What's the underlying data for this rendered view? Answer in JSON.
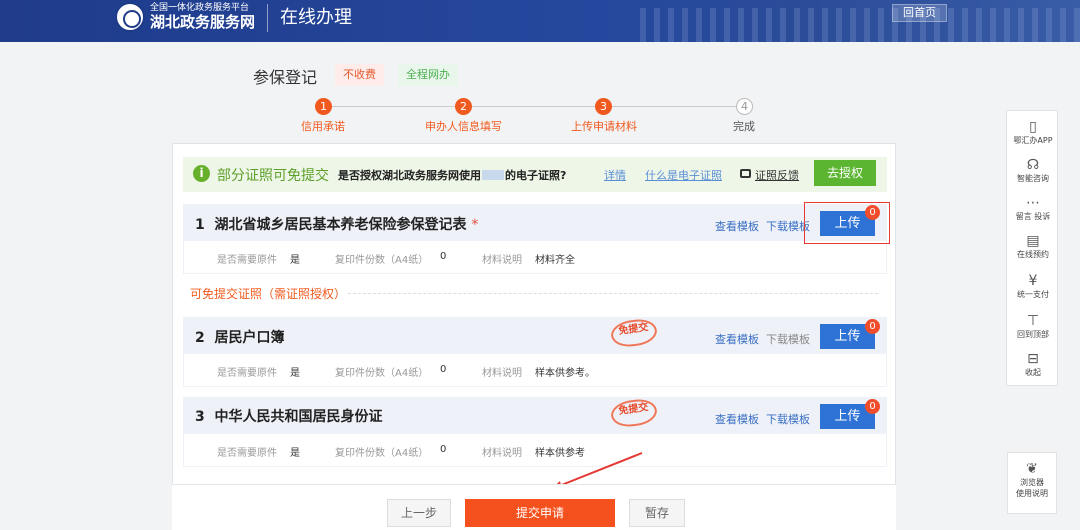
{
  "header": {
    "platform_tag": "全国一体化政务服务平台",
    "site_name": "湖北政务服务网",
    "title": "在线办理",
    "home_button": "回首页"
  },
  "service": {
    "title": "参保登记",
    "fee_tag": "不收费",
    "online_tag": "全程网办"
  },
  "steps": [
    {
      "num": "1",
      "label": "信用承诺",
      "state": "done"
    },
    {
      "num": "2",
      "label": "申办人信息填写",
      "state": "done"
    },
    {
      "num": "3",
      "label": "上传申请材料",
      "state": "current"
    },
    {
      "num": "4",
      "label": "完成",
      "state": "todo"
    }
  ],
  "notice": {
    "title": "部分证照可免提交",
    "question": "是否授权湖北政务服务网使用",
    "question_tail": "的电子证照?",
    "details_link": "详情",
    "what_is_link": "什么是电子证照",
    "feedback_link": "证照反馈",
    "authorize_button": "去授权"
  },
  "meta_labels": {
    "original": "是否需要原件",
    "copies": "复印件份数（A4纸）",
    "note": "材料说明"
  },
  "materials": [
    {
      "index": "1",
      "name": "湖北省城乡居民基本养老保险参保登记表",
      "required_mark": "*",
      "view_template": "查看模板",
      "download_template": "下载模板",
      "upload": "上传",
      "badge": "0",
      "original": "是",
      "copies": "0",
      "note": "材料齐全"
    },
    {
      "index": "2",
      "name": "居民户口簿",
      "view_template": "查看模板",
      "download_template": "下载模板",
      "upload": "上传",
      "badge": "0",
      "original": "是",
      "copies": "0",
      "note": "样本供参考。"
    },
    {
      "index": "3",
      "name": "中华人民共和国居民身份证",
      "view_template": "查看模板",
      "download_template": "下载模板",
      "upload": "上传",
      "badge": "0",
      "original": "是",
      "copies": "0",
      "note": "样本供参考"
    }
  ],
  "exempt_section_title": "可免提交证照（需证照授权）",
  "stamp_text": "免提交",
  "footer": {
    "prev": "上一步",
    "submit": "提交申请",
    "save": "暂存"
  },
  "sidebar": {
    "items": [
      {
        "icon": "phone-icon",
        "label": "鄂汇办APP"
      },
      {
        "icon": "headset-icon",
        "label": "智能咨询"
      },
      {
        "icon": "message-icon",
        "label": "留言 投诉"
      },
      {
        "icon": "calendar-icon",
        "label": "在线预约"
      },
      {
        "icon": "yuan-icon",
        "label": "统一支付"
      },
      {
        "icon": "back-to-top-icon",
        "label": "回到顶部"
      },
      {
        "icon": "collapse-icon",
        "label": "收起"
      }
    ],
    "guide_label_1": "浏览器",
    "guide_label_2": "使用说明"
  },
  "colors": {
    "header_bg": "#25489e",
    "accent_orange": "#f05a1e",
    "upload_blue": "#2e72d6",
    "authorize_green": "#5cb531",
    "highlight_red": "#e53935"
  }
}
